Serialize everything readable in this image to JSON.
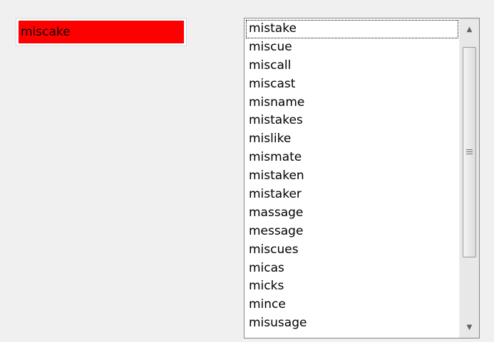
{
  "input": {
    "value": "miscake",
    "background_color": "#ff0000"
  },
  "listbox": {
    "items": [
      "mistake",
      "miscue",
      "miscall",
      "miscast",
      "misname",
      "mistakes",
      "mislike",
      "mismate",
      "mistaken",
      "mistaker",
      "massage",
      "message",
      "miscues",
      "micas",
      "micks",
      "mince",
      "misusage"
    ],
    "focused_index": 0
  },
  "scrollbar": {
    "up_icon": "▲",
    "down_icon": "▼"
  }
}
